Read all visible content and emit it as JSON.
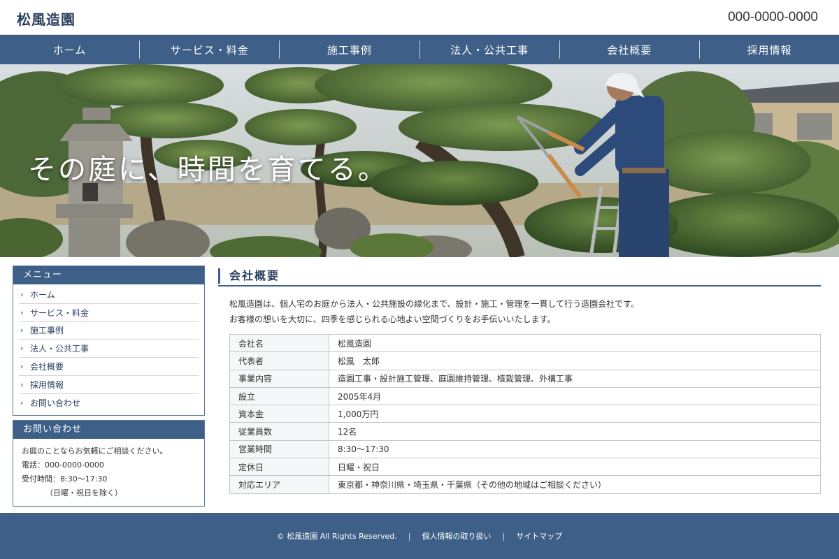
{
  "header": {
    "logo": "松風造園",
    "phone": "000-0000-0000"
  },
  "nav": [
    {
      "label": "ホーム"
    },
    {
      "label": "サービス・料金"
    },
    {
      "label": "施工事例"
    },
    {
      "label": "法人・公共工事"
    },
    {
      "label": "会社概要"
    },
    {
      "label": "採用情報"
    }
  ],
  "hero": {
    "catchcopy": "その庭に、時間を育てる。"
  },
  "sidebar": {
    "menu_title": "メニュー",
    "menu": [
      {
        "label": "ホーム"
      },
      {
        "label": "サービス・料金"
      },
      {
        "label": "施工事例"
      },
      {
        "label": "法人・公共工事"
      },
      {
        "label": "会社概要"
      },
      {
        "label": "採用情報"
      },
      {
        "label": "お問い合わせ"
      }
    ],
    "contact": {
      "title": "お問い合わせ",
      "line1": "お庭のことならお気軽にご相談ください。",
      "phone": "電話：000-0000-0000",
      "hours": "受付時間：8:30〜17:30",
      "closed": "（日曜・祝日を除く）"
    }
  },
  "main": {
    "title": "会社概要",
    "intro1": "松風造園は、個人宅のお庭から法人・公共施設の緑化まで、設計・施工・管理を一貫して行う造園会社です。",
    "intro2": "お客様の想いを大切に、四季を感じられる心地よい空間づくりをお手伝いいたします。",
    "profile": [
      {
        "label": "会社名",
        "value": "松風造園"
      },
      {
        "label": "代表者",
        "value": "松風　太郎"
      },
      {
        "label": "事業内容",
        "value": "造園工事・設計施工管理、庭園維持管理、植栽管理、外構工事"
      },
      {
        "label": "設立",
        "value": "2005年4月"
      },
      {
        "label": "資本金",
        "value": "1,000万円"
      },
      {
        "label": "従業員数",
        "value": "12名"
      },
      {
        "label": "営業時間",
        "value": "8:30〜17:30"
      },
      {
        "label": "定休日",
        "value": "日曜・祝日"
      },
      {
        "label": "対応エリア",
        "value": "東京都・神奈川県・埼玉県・千葉県（その他の地域はご相談ください）"
      }
    ]
  },
  "footer": {
    "copyright": "© 松風造園 All Rights Reserved.",
    "privacy": "個人情報の取り扱い",
    "sitemap": "サイトマップ"
  },
  "colors": {
    "primary": "#3e5f87",
    "primary_dark": "#2a3f5f",
    "border": "#bfc6cf"
  }
}
